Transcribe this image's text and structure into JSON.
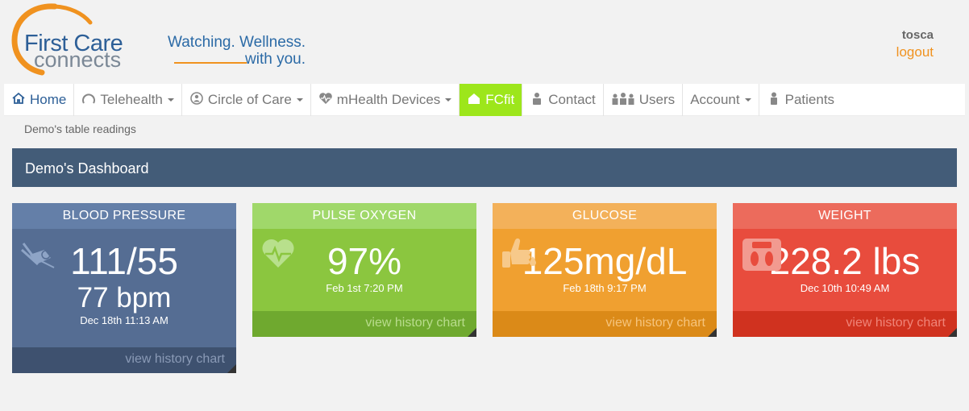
{
  "brand": {
    "logo_line1": "First Care",
    "logo_line2": "connects",
    "tagline_line1": "Watching. Wellness.",
    "tagline_line2": "with you."
  },
  "user": {
    "name": "tosca",
    "logout_label": "logout"
  },
  "nav": {
    "home": "Home",
    "telehealth": "Telehealth",
    "circle_of_care": "Circle of Care",
    "mhealth_devices": "mHealth Devices",
    "fcfit": "FCfit",
    "contact": "Contact",
    "users": "Users",
    "account": "Account",
    "patients": "Patients"
  },
  "breadcrumb": "Demo's table readings",
  "dashboard_title": "Demo's Dashboard",
  "cards": {
    "blood_pressure": {
      "title": "BLOOD PRESSURE",
      "value": "111/55",
      "secondary": "77 bpm",
      "date": "Dec 18th 11:13 AM",
      "link": "view history chart",
      "icon": "bp-cuff-icon"
    },
    "pulse_oxygen": {
      "title": "PULSE OXYGEN",
      "value": "97%",
      "date": "Feb 1st 7:20 PM",
      "link": "view history chart",
      "icon": "heart-pulse-icon"
    },
    "glucose": {
      "title": "GLUCOSE",
      "value": "125mg/dL",
      "date": "Feb 18th 9:17 PM",
      "link": "view history chart",
      "icon": "finger-drop-icon"
    },
    "weight": {
      "title": "WEIGHT",
      "value": "228.2 lbs",
      "date": "Dec 10th 10:49 AM",
      "link": "view history chart",
      "icon": "scale-icon"
    }
  },
  "colors": {
    "brand_blue": "#2d5f97",
    "brand_orange": "#f0921f",
    "fcfit_active": "#9de61b",
    "dashboard_bar": "#435c78"
  }
}
